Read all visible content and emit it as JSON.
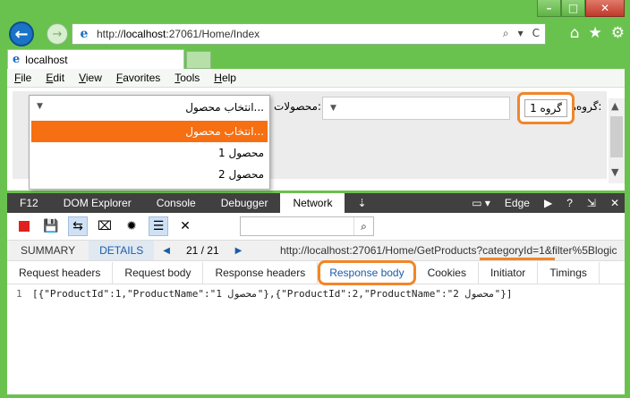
{
  "window": {
    "buttons": [
      "–",
      "□",
      "✕"
    ]
  },
  "address_bar": {
    "url_prefix": "http://",
    "url_host": "localhost",
    "url_rest": ":27061/Home/Index",
    "tools": [
      "⌕",
      "▾",
      "C"
    ]
  },
  "nav_right_icons": [
    "⌂",
    "★",
    "⚙"
  ],
  "tab": {
    "title": "localhost"
  },
  "menu": [
    {
      "label": "File",
      "u": "F",
      "rest": "ile"
    },
    {
      "label": "Edit",
      "u": "E",
      "rest": "dit"
    },
    {
      "label": "View",
      "u": "V",
      "rest": "iew"
    },
    {
      "label": "Favorites",
      "u": "F",
      "rest": "avorites"
    },
    {
      "label": "Tools",
      "u": "T",
      "rest": "ools"
    },
    {
      "label": "Help",
      "u": "H",
      "rest": "elp"
    }
  ],
  "page": {
    "groups_label": "گروه‌ها:",
    "group_selected": "گروه 1",
    "products_label": "محصولات:",
    "product_placeholder": "انتخاب محصول...",
    "product_options": [
      "انتخاب محصول...",
      "محصول 1",
      "محصول 2"
    ],
    "selected_option_index": 0
  },
  "devtools": {
    "tabs": [
      "F12",
      "DOM Explorer",
      "Console",
      "Debugger",
      "Network"
    ],
    "active_tab": "Network",
    "mode_label": "Edge",
    "nav": {
      "summary": "SUMMARY",
      "details": "DETAILS",
      "prev": "◀",
      "count": "21 / 21",
      "next": "▶",
      "request_url": "http://localhost:27061/Home/GetProducts?categoryId=1&filter%5Blogic"
    },
    "subtabs": [
      "Request headers",
      "Request body",
      "Response headers",
      "Response body",
      "Cookies",
      "Initiator",
      "Timings"
    ],
    "active_subtab": "Response body",
    "response": {
      "line_number": "1",
      "body": "[{\"ProductId\":1,\"ProductName\":\"محصول 1\"},{\"ProductId\":2,\"ProductName\":\"محصول 2\"}]"
    }
  },
  "colors": {
    "frame": "#6ac24e",
    "highlight": "#f0862a",
    "selected_option": "#f66f12",
    "devtools_bar": "#404040"
  }
}
